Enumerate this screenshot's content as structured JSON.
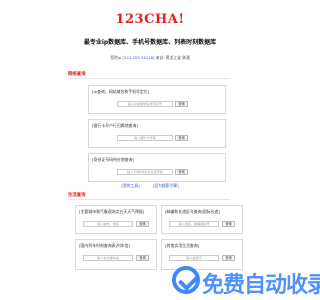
{
  "header": {
    "logo": "123CHA!",
    "subtitle": "最专业ip数据库、手机号数据库、列表时刻数据库",
    "ip_prefix": "您的ip",
    "ip_value": "[221.253.34118]",
    "ip_suffix": "来自: 黑龙江省 联通"
  },
  "sections": {
    "network": {
      "title": "网络查询"
    },
    "life": {
      "title": "生活查询"
    }
  },
  "network_tools": [
    {
      "label": "[ip查询、网站域名和手机号定位]",
      "placeholder": "输入ip或者域名或手机号",
      "button": "查询"
    },
    {
      "label": "[银行卡开户行归属地查询]",
      "placeholder": "输入银行卡号码",
      "button": "查询"
    },
    {
      "label": "[身份证号码所在地查询]",
      "placeholder": "输入15或18位身份证号码",
      "button": "查询"
    }
  ],
  "links": {
    "left": "[我的工具]",
    "right": "[设为搜索引擎]"
  },
  "life_tools": [
    {
      "label": "[主要城市和气象观测点五天天气预报]",
      "placeholder": "输入城市、地区",
      "button": "查询"
    },
    {
      "label": "[邮编和长途区号查询|国际长途]",
      "placeholder": "输入地区、邮编或区号",
      "button": "查询"
    },
    {
      "label": "[国内列车时刻查询表|列车信]",
      "placeholder": "输入车次或车站",
      "button": "查询"
    },
    {
      "label": "[其他实用生活查询]",
      "placeholder": "输入关键字",
      "button": "查询"
    }
  ],
  "watermark": {
    "text": "免费自动收录"
  },
  "colors": {
    "accent": "#e02020",
    "link": "#2a56c6",
    "watermark": "#3f88ff"
  }
}
